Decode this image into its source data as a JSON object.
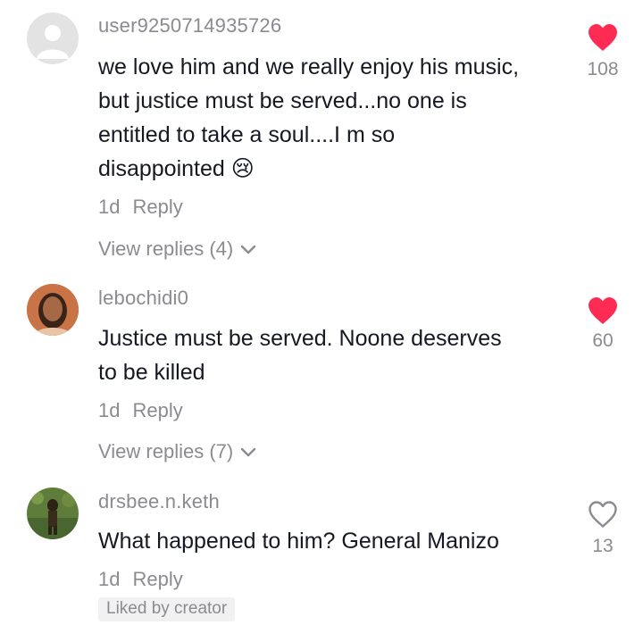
{
  "comments": [
    {
      "username": "user9250714935726",
      "text_lines": [
        "we love him and we really enjoy his music,",
        "but justice must be served...no one is",
        "entitled to take a soul....I m so",
        "disappointed"
      ],
      "emoji": "😢",
      "age": "1d",
      "reply_label": "Reply",
      "view_replies": "View replies (4)",
      "like_count": "108",
      "liked": true,
      "avatar": "default-avatar-icon"
    },
    {
      "username": "lebochidi0",
      "text_lines": [
        "Justice must be served. Noone deserves",
        "to be killed"
      ],
      "age": "1d",
      "reply_label": "Reply",
      "view_replies": "View replies (7)",
      "like_count": "60",
      "liked": true,
      "avatar": "profile-photo"
    },
    {
      "username": "drsbee.n.keth",
      "text_lines": [
        "What happened to him? General Manizo"
      ],
      "age": "1d",
      "reply_label": "Reply",
      "like_count": "13",
      "liked": false,
      "badge": "Liked by creator",
      "avatar": "profile-photo"
    }
  ],
  "colors": {
    "like_active": "#fe2c55",
    "secondary_text": "#8a8b91",
    "primary_text": "#161823",
    "badge_bg": "#f1f1f2"
  }
}
